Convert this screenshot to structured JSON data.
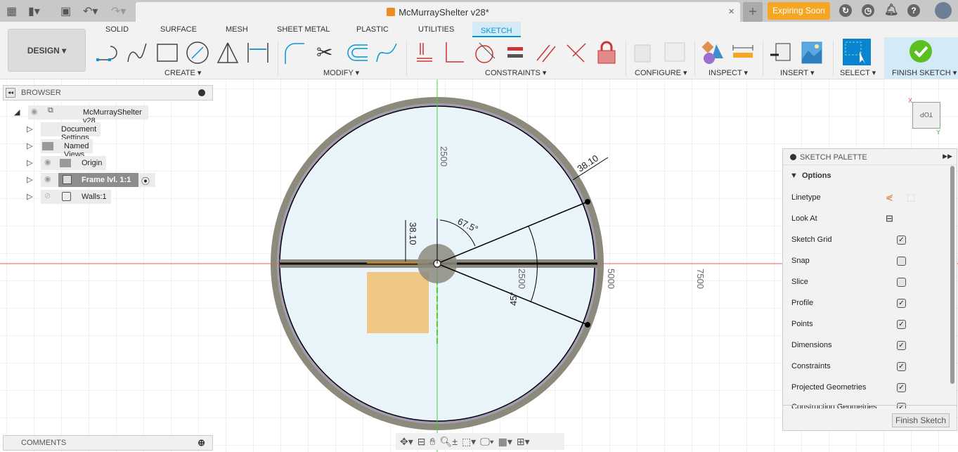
{
  "topbar": {
    "title": "McMurrayShelter v28*",
    "expiring": "Expiring Soon",
    "new_tab": "+",
    "close": "×"
  },
  "ribbon": {
    "workspace": "DESIGN ▾",
    "tabs": [
      "SOLID",
      "SURFACE",
      "MESH",
      "SHEET METAL",
      "PLASTIC",
      "UTILITIES",
      "SKETCH"
    ],
    "active_tab": "SKETCH",
    "groups": [
      "CREATE ▾",
      "MODIFY ▾",
      "CONSTRAINTS ▾",
      "CONFIGURE ▾",
      "INSPECT ▾",
      "INSERT ▾",
      "SELECT ▾",
      "FINISH SKETCH ▾"
    ]
  },
  "browser": {
    "title": "BROWSER",
    "items": [
      {
        "label": "McMurrayShelter v28"
      },
      {
        "label": "Document Settings"
      },
      {
        "label": "Named Views"
      },
      {
        "label": "Origin"
      },
      {
        "label": "Frame lvl. 1:1"
      },
      {
        "label": "Walls:1"
      }
    ]
  },
  "comments": {
    "title": "COMMENTS"
  },
  "viewcube": {
    "face": "TOP",
    "x": "X",
    "y": "Y"
  },
  "canvas": {
    "dims": {
      "wall_thickness": "38.10",
      "bar_thickness": "38.10",
      "angle1": "67.5°",
      "angle2": "45°",
      "grid_2500_v": "2500",
      "grid_2500_h": "2500",
      "grid_5000": "5000",
      "grid_7500": "7500"
    },
    "colors": {
      "x_axis": "#e06060",
      "y_axis": "#40d040",
      "wall": "#8c8a7c",
      "fill": "#eaf4fb",
      "profile": "#f0c070"
    }
  },
  "palette": {
    "title": "SKETCH PALETTE",
    "section": "Options",
    "rows": [
      {
        "label": "Linetype",
        "type": "icons"
      },
      {
        "label": "Look At",
        "type": "icon"
      },
      {
        "label": "Sketch Grid",
        "checked": true
      },
      {
        "label": "Snap",
        "checked": false
      },
      {
        "label": "Slice",
        "checked": false
      },
      {
        "label": "Profile",
        "checked": true
      },
      {
        "label": "Points",
        "checked": true
      },
      {
        "label": "Dimensions",
        "checked": true
      },
      {
        "label": "Constraints",
        "checked": true
      },
      {
        "label": "Projected Geometries",
        "checked": true
      },
      {
        "label": "Construction Geometries",
        "checked": true
      }
    ],
    "finish": "Finish Sketch"
  }
}
